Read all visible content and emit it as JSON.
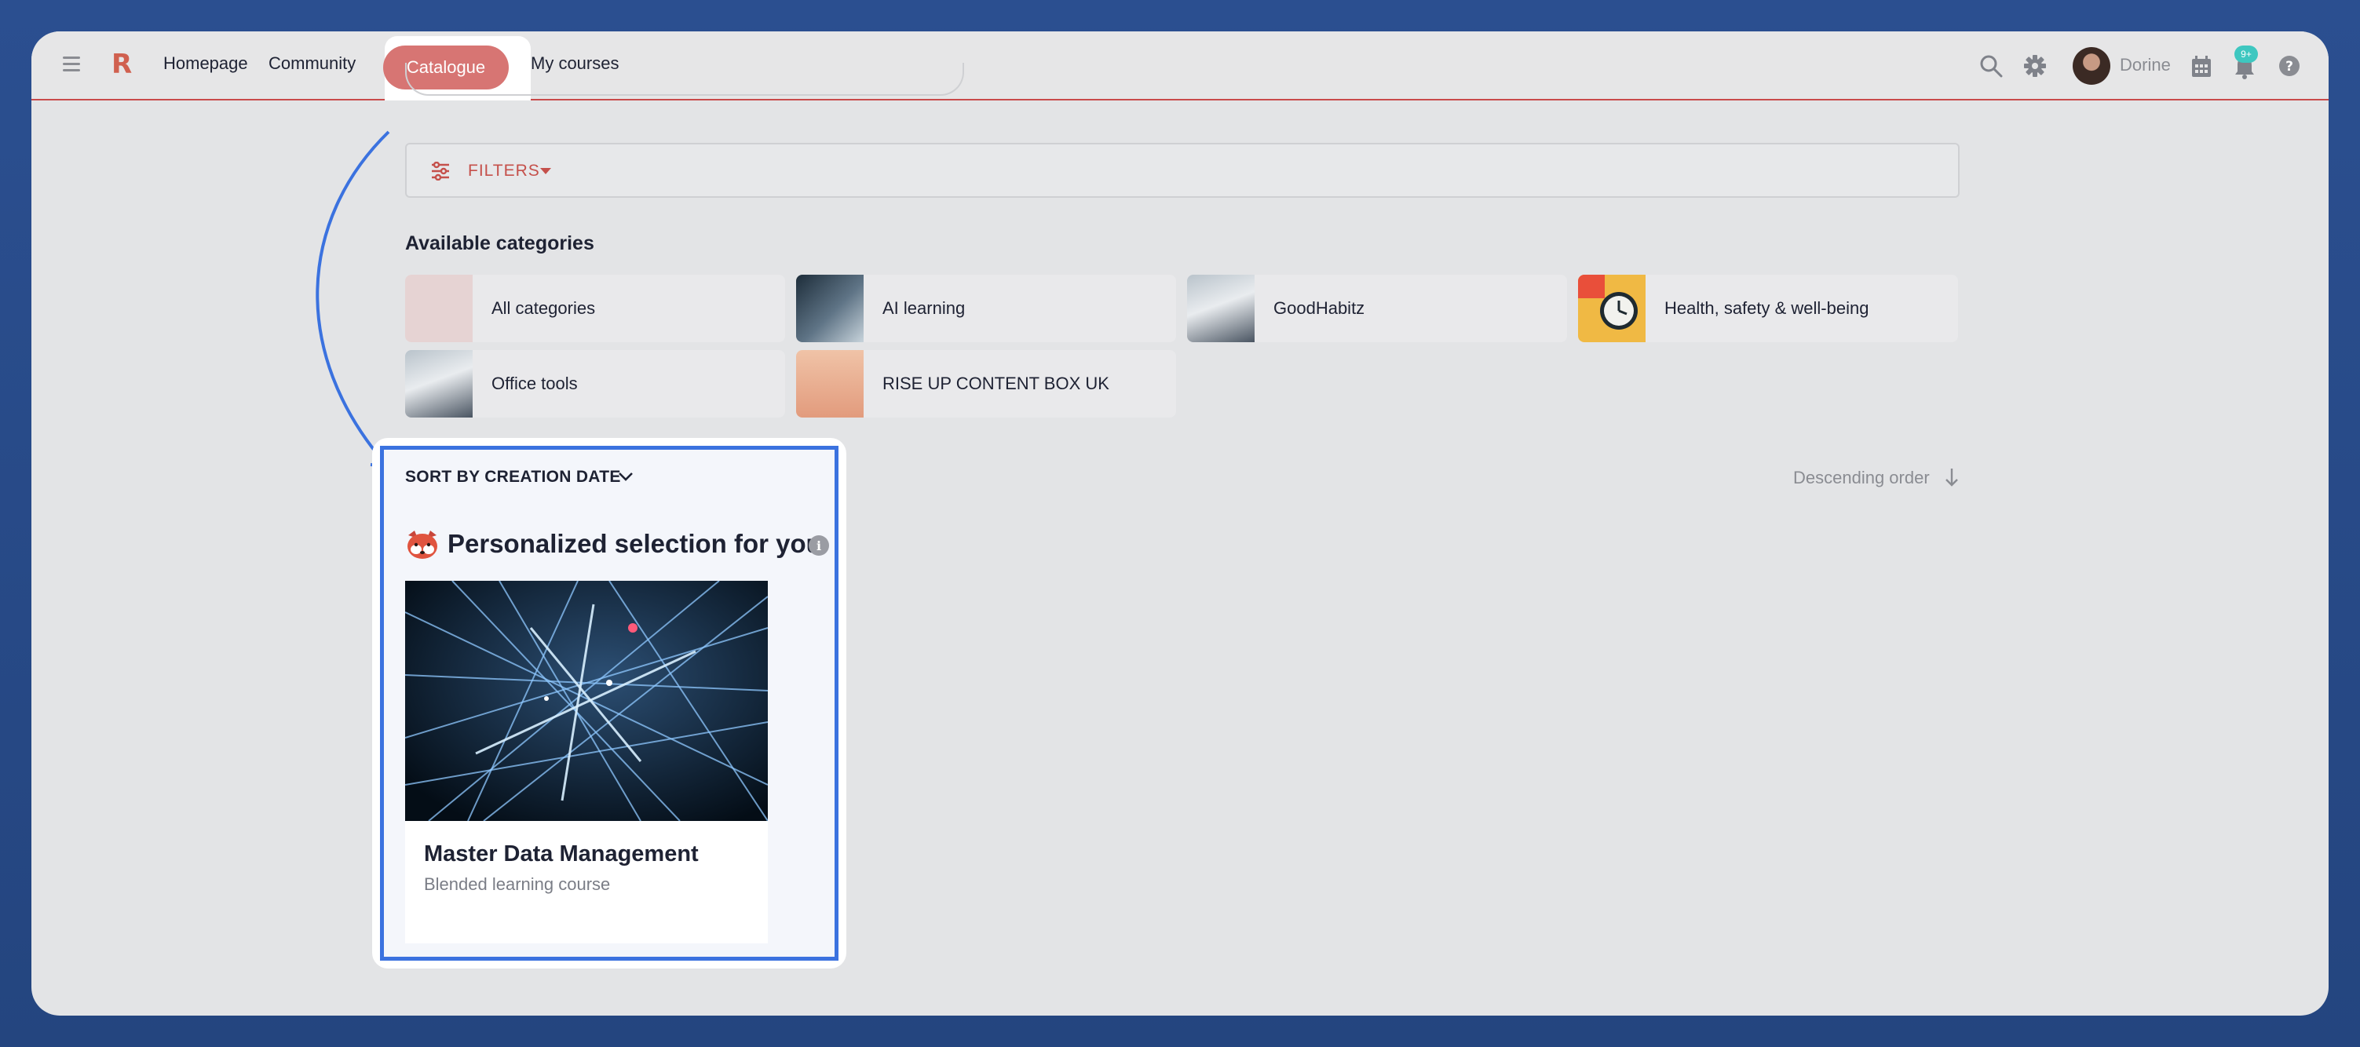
{
  "nav": {
    "home": "Homepage",
    "community": "Community",
    "catalogue": "Catalogue",
    "my_courses": "My courses",
    "user_name": "Dorine",
    "notif_badge": "9+",
    "logo": "R"
  },
  "filters": {
    "label": "FILTERS"
  },
  "categories": {
    "title": "Available categories",
    "items": [
      {
        "label": "All categories"
      },
      {
        "label": "AI learning"
      },
      {
        "label": "GoodHabitz"
      },
      {
        "label": "Health, safety & well-being"
      },
      {
        "label": "Office tools"
      },
      {
        "label": "RISE UP CONTENT BOX UK"
      }
    ]
  },
  "sort": {
    "label": "SORT BY CREATION DATE",
    "order": "Descending order"
  },
  "personalized": {
    "title": "Personalized selection for you",
    "info": "i",
    "course": {
      "title": "Master Data Management",
      "subtitle": "Blended learning course"
    }
  },
  "colors": {
    "accent": "#d77573",
    "filter_red": "#c5504b",
    "highlight_blue": "#3b72df",
    "badge_teal": "#3ec7c0"
  }
}
